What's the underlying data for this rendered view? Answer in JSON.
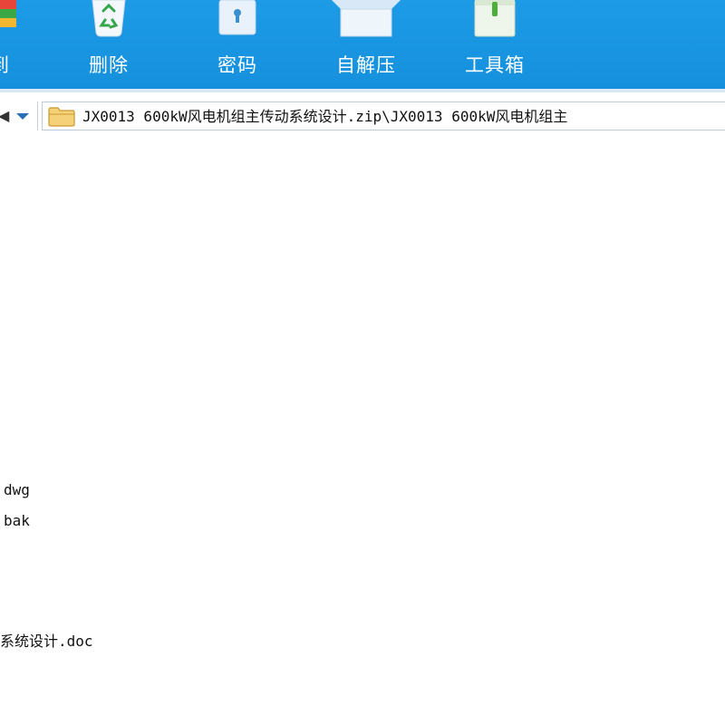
{
  "toolbar": {
    "tools": [
      {
        "label": "到",
        "icon": "partial-tool-icon"
      },
      {
        "label": "删除",
        "icon": "recycle-bin-icon"
      },
      {
        "label": "密码",
        "icon": "lock-icon"
      },
      {
        "label": "自解压",
        "icon": "box-icon"
      },
      {
        "label": "工具箱",
        "icon": "toolbox-icon"
      }
    ]
  },
  "address": {
    "path": "JX0013 600kW风电机组主传动系统设计.zip\\JX0013 600kW风电机组主"
  },
  "files": [
    "dwg",
    "bak",
    "",
    "",
    "系统设计.doc"
  ],
  "colors": {
    "toolbar_bg": "#1590dd",
    "address_arrow": "#2a6db8"
  }
}
